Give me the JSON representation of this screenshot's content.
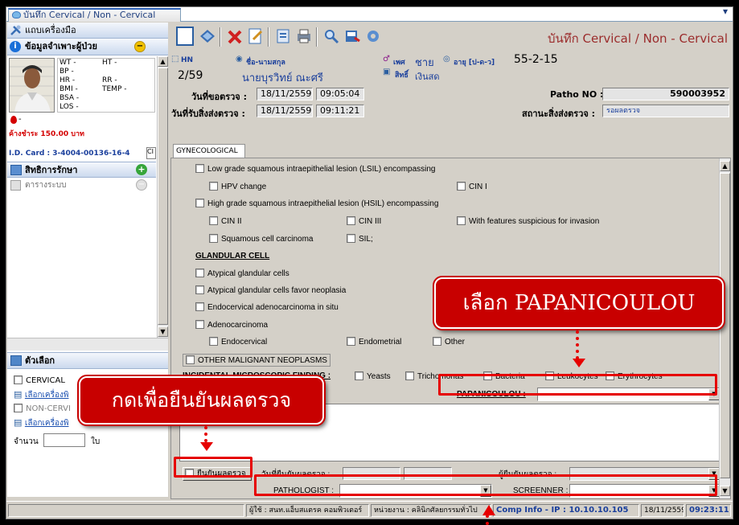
{
  "window": {
    "tab_title": "บันทึก Cervical / Non - Cervical",
    "pin_glyph": "▾"
  },
  "left": {
    "toolbar_label": "แถบเครื่องมือ",
    "patient_section": "ข้อมูลจำเพาะผู้ป่วย",
    "vitals_left": [
      "WT -",
      "BP -",
      "HR -",
      "BMI -",
      "BSA -",
      "LOS -"
    ],
    "vitals_right": [
      "HT -",
      "RR -",
      "TEMP -"
    ],
    "balance": "ค้างชำระ 150.00 บาท",
    "id_card": "I.D. Card : 3-4004-00136-16-4",
    "id_btn": "CI",
    "rights_section": "สิทธิการรักษา",
    "rights_item": "ตารางระบบ",
    "options_section": "ตัวเลือก",
    "cervical": "CERVICAL",
    "print_link1": "เลือกเครื่องพิ",
    "non_cervical": "NON-CERVI",
    "print_link2": "เลือกเครื่องพิ",
    "count_label": "จำนวน",
    "count_unit": "ใบ"
  },
  "header": {
    "title": "บันทึก Cervical / Non - Cervical",
    "hn_label": "HN",
    "hn_value": "2/59",
    "name_label": "ชื่อ-นามสกุล",
    "name_value": "นายบุรวิทย์ ณะศรี",
    "sex_label": "เพศ",
    "sex_value": "ชาย",
    "age_label": "อายุ [ป-ด-ว]",
    "age_value": "55-2-15",
    "rights_label": "สิทธิ์",
    "rights_value": "เงินสด",
    "req_date_label": "วันที่ขอตรวจ :",
    "req_date": "18/11/2559",
    "req_time": "09:05:04",
    "recv_date_label": "วันที่รับสิ่งส่งตรวจ :",
    "recv_date": "18/11/2559",
    "recv_time": "09:11:21",
    "patho_label": "Patho NO :",
    "patho_value": "590003952",
    "status_label": "สถานะสิ่งส่งตรวจ :",
    "status_value": "รอผลตรวจ"
  },
  "form": {
    "tab": "GYNECOLOGICAL",
    "lsil": "Low grade squamous intraepithelial lesion (LSIL) encompassing",
    "hpv": "HPV change",
    "cin1": "CIN I",
    "hsil": "High grade squamous intraepithelial lesion (HSIL) encompassing",
    "cin2": "CIN II",
    "cin3": "CIN III",
    "invasion": "With features suspicious for invasion",
    "scc": "Squamous cell carcinoma",
    "sil": "SIL;",
    "glandular": "GLANDULAR CELL",
    "agc": "Atypical glandular cells",
    "agc_neo": "Atypical glandular cells favor neoplasia",
    "ais": "Endocervical adenocarcinoma in situ",
    "adeno": "Adenocarcinoma",
    "endocervical": "Endocervical",
    "endometrial": "Endometrial",
    "other_small": "Other",
    "other_malig": "OTHER MALIGNANT NEOPLASMS",
    "incidental": "INCIDENTAL MICROSCOPIC FINDING :",
    "yeasts": "Yeasts",
    "trich": "Trichomonas",
    "bacteria": "Bacteria",
    "leuko": "Leukocytes",
    "erythro": "Erythrocytes",
    "papanicoulou": "PAPANICOULOU :",
    "confirm": "ยืนยันผลตรวจ",
    "confirm_date": "วันที่ยืนยันผลตรวจ :",
    "confirm_by": "ผู้ยืนยันผลตรวจ :",
    "pathologist": "PATHOLOGIST :",
    "screener": "SCREENNER :"
  },
  "status": {
    "user": "ผู้ใช้ : สนท.แอ็บสแตรค คอมพิวเตอร์",
    "unit": "หน่วยงาน : คลินิกศัลยกรรมทั่วไป",
    "ip": "Comp Info - IP : 10.10.10.105",
    "date": "18/11/2559",
    "time": "09:23:11"
  },
  "annotations": {
    "select_papanicoulou": "เลือก PAPANICOULOU",
    "press_confirm": "กดเพื่อยืนยันผลตรวจ"
  }
}
